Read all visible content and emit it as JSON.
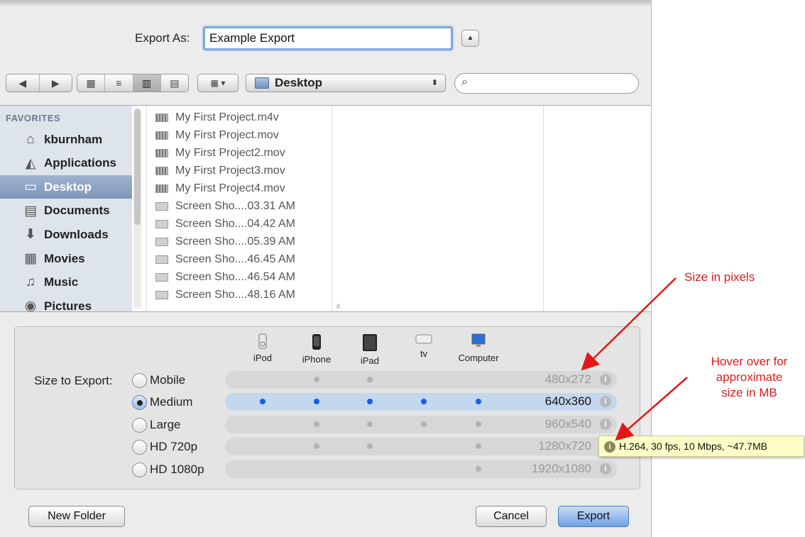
{
  "dialog": {
    "export_as_label": "Export As:",
    "filename_value": "Example Export",
    "expand_glyph": "▲"
  },
  "toolbar": {
    "back_glyph": "◀",
    "forward_glyph": "▶",
    "view_icons": [
      "icon-view-icon",
      "list-view-icon",
      "column-view-icon",
      "cover-flow-icon"
    ],
    "view_glyphs": [
      "▦",
      "≡",
      "▥",
      "▤"
    ],
    "arrange_glyph": "▦ ▾",
    "location": "Desktop",
    "location_arrows": "⬍",
    "search_placeholder": "",
    "search_glyph": "⌕"
  },
  "sidebar": {
    "heading": "FAVORITES",
    "items": [
      {
        "label": "kburnham",
        "icon": "home-icon",
        "glyph": "⌂"
      },
      {
        "label": "Applications",
        "icon": "applications-icon",
        "glyph": "◭"
      },
      {
        "label": "Desktop",
        "icon": "desktop-icon",
        "glyph": "▭",
        "selected": true
      },
      {
        "label": "Documents",
        "icon": "documents-icon",
        "glyph": "▤"
      },
      {
        "label": "Downloads",
        "icon": "downloads-icon",
        "glyph": "⬇"
      },
      {
        "label": "Movies",
        "icon": "movies-icon",
        "glyph": "▦"
      },
      {
        "label": "Music",
        "icon": "music-icon",
        "glyph": "♫"
      },
      {
        "label": "Pictures",
        "icon": "pictures-icon",
        "glyph": "◉"
      }
    ]
  },
  "files": [
    {
      "name": "My First Project.m4v",
      "type": "movie"
    },
    {
      "name": "My First Project.mov",
      "type": "movie"
    },
    {
      "name": "My First Project2.mov",
      "type": "movie"
    },
    {
      "name": "My First Project3.mov",
      "type": "movie"
    },
    {
      "name": "My First Project4.mov",
      "type": "movie"
    },
    {
      "name": "Screen Sho....03.31 AM",
      "type": "image"
    },
    {
      "name": "Screen Sho....04.42 AM",
      "type": "image"
    },
    {
      "name": "Screen Sho....05.39 AM",
      "type": "image"
    },
    {
      "name": "Screen Sho....46.45 AM",
      "type": "image"
    },
    {
      "name": "Screen Sho....46.54 AM",
      "type": "image"
    },
    {
      "name": "Screen Sho....48.16 AM",
      "type": "image"
    }
  ],
  "export_panel": {
    "size_label": "Size to Export:",
    "devices": [
      {
        "label": "iPod",
        "icon": "ipod-icon"
      },
      {
        "label": "iPhone",
        "icon": "iphone-icon"
      },
      {
        "label": "iPad",
        "icon": "ipad-icon"
      },
      {
        "label": "tv",
        "icon": "apple-tv-icon"
      },
      {
        "label": "Computer",
        "icon": "computer-icon"
      }
    ],
    "apple_glyph": "",
    "options": [
      {
        "label": "Mobile",
        "resolution": "480x272",
        "selected": false,
        "support": [
          "none",
          "gray",
          "gray",
          "none",
          "none"
        ]
      },
      {
        "label": "Medium",
        "resolution": "640x360",
        "selected": true,
        "support": [
          "blue",
          "blue",
          "blue",
          "blue",
          "blue"
        ]
      },
      {
        "label": "Large",
        "resolution": "960x540",
        "selected": false,
        "support": [
          "none",
          "gray",
          "gray",
          "gray",
          "gray"
        ]
      },
      {
        "label": "HD 720p",
        "resolution": "1280x720",
        "selected": false,
        "support": [
          "none",
          "gray",
          "gray",
          "none",
          "gray"
        ]
      },
      {
        "label": "HD 1080p",
        "resolution": "1920x1080",
        "selected": false,
        "support": [
          "none",
          "none",
          "none",
          "none",
          "gray"
        ]
      }
    ],
    "info_glyph": "i",
    "tooltip": "H.264, 30 fps, 10 Mbps, ~47.7MB"
  },
  "buttons": {
    "new_folder": "New Folder",
    "cancel": "Cancel",
    "export": "Export"
  },
  "annotations": {
    "size_in_pixels": "Size in pixels",
    "hover_lines": [
      "Hover over for",
      "approximate",
      "size in MB"
    ],
    "color": "#e51717"
  }
}
